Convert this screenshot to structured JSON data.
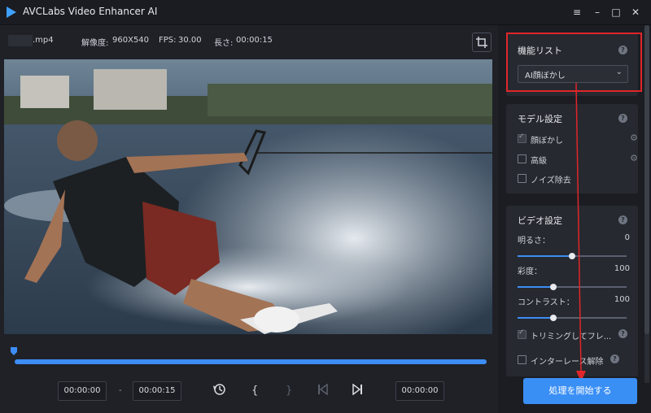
{
  "app": {
    "title": "AVCLabs Video Enhancer AI"
  },
  "window_controls": [
    "≡",
    "–",
    "□",
    "✕"
  ],
  "info": {
    "filename": ".mp4",
    "resolution_label": "解像度:",
    "resolution_value": "960X540",
    "fps_label": "FPS:",
    "fps_value": "30.00",
    "length_label": "長さ:",
    "length_value": "00:00:15"
  },
  "timeline": {
    "progress": 1.0
  },
  "controls": {
    "start_time": "00:00:00",
    "separator": "-",
    "end_time": "00:00:15",
    "current_time": "00:00:00",
    "mark_in": "{",
    "mark_out": "}"
  },
  "features": {
    "title": "機能リスト",
    "selected": "AI顔ぼかし"
  },
  "model": {
    "title": "モデル設定",
    "options": [
      {
        "label": "顔ぼかし",
        "checked": true
      },
      {
        "label": "高級",
        "checked": false
      },
      {
        "label": "ノイズ除去",
        "checked": false
      }
    ]
  },
  "video_settings": {
    "title": "ビデオ設定",
    "brightness": {
      "label": "明るさ：",
      "value": "0",
      "level": 0.5
    },
    "saturation": {
      "label": "彩度：",
      "value": "100",
      "level": 0.33
    },
    "contrast": {
      "label": "コントラスト：",
      "value": "100",
      "level": 0.33
    },
    "trim_label": "トリミングしてフレ...",
    "deinterlace_label": "インターレース解除"
  },
  "start_button": "処理を開始する",
  "colors": {
    "accent": "#3a8ff5",
    "highlight": "#e0262a"
  }
}
